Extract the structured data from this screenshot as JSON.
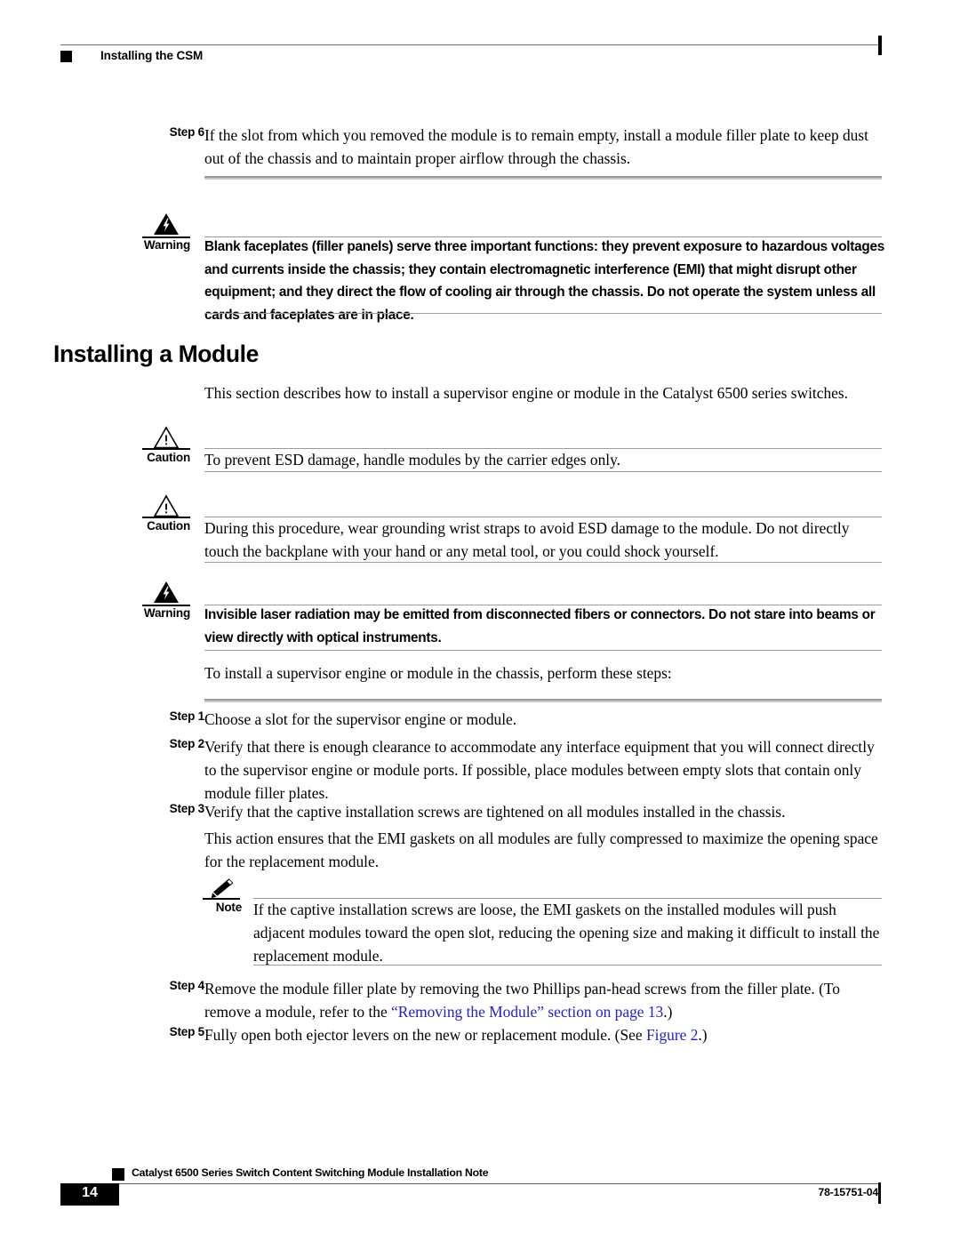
{
  "header": {
    "title": "Installing the CSM",
    "marker_icon": "black-square-bullet-icon"
  },
  "step6": {
    "label": "Step 6",
    "text": "If the slot from which you removed the module is to remain empty, install a module filler plate to keep dust out of the chassis and to maintain proper airflow through the chassis."
  },
  "warning1": {
    "label": "Warning",
    "icon": "warning-lightning-triangle-icon",
    "text": "Blank faceplates (filler panels) serve three important functions: they prevent exposure to hazardous voltages and currents inside the chassis; they contain electromagnetic interference (EMI) that might disrupt other equipment; and they direct the flow of cooling air through the chassis. Do not operate the system unless all cards and faceplates are in place."
  },
  "section": {
    "heading": "Installing a Module",
    "intro": "This section describes how to install a supervisor engine or module in the Catalyst 6500 series switches."
  },
  "caution1": {
    "label": "Caution",
    "icon": "caution-exclamation-triangle-icon",
    "text": "To prevent ESD damage, handle modules by the carrier edges only."
  },
  "caution2": {
    "label": "Caution",
    "icon": "caution-exclamation-triangle-icon",
    "text": "During this procedure, wear grounding wrist straps to avoid ESD damage to the module. Do not directly touch the backplane with your hand or any metal tool, or you could shock yourself."
  },
  "warning2": {
    "label": "Warning",
    "icon": "warning-lightning-triangle-icon",
    "text": "Invisible laser radiation may be emitted from disconnected fibers or connectors. Do not stare into beams or view directly with optical instruments."
  },
  "procedure": {
    "intro": "To install a supervisor engine or module in the chassis, perform these steps:",
    "steps": [
      {
        "label": "Step 1",
        "text": "Choose a slot for the supervisor engine or module."
      },
      {
        "label": "Step 2",
        "text": "Verify that there is enough clearance to accommodate any interface equipment that you will connect directly to the supervisor engine or module ports. If possible, place modules between empty slots that contain only module filler plates."
      },
      {
        "label": "Step 3",
        "text": "Verify that the captive installation screws are tightened on all modules installed in the chassis."
      }
    ],
    "step3_followup": "This action ensures that the EMI gaskets on all modules are fully compressed to maximize the opening space for the replacement module."
  },
  "note": {
    "label": "Note",
    "icon": "note-pencil-icon",
    "text": "If the captive installation screws are loose, the EMI gaskets on the installed modules will push adjacent modules toward the open slot, reducing the opening size and making it difficult to install the replacement module."
  },
  "step4": {
    "label": "Step 4",
    "text_before": "Remove the module filler plate by removing the two Phillips pan-head screws from the filler plate. (To remove a module, refer to the ",
    "link_text": "“Removing the Module” section on page 13",
    "text_after": ".)"
  },
  "step5": {
    "label": "Step 5",
    "text_before": "Fully open both ejector levers on the new or replacement module. (See ",
    "link_text": "Figure 2",
    "text_after": ".)"
  },
  "footer": {
    "page_number": "14",
    "title": "Catalyst 6500 Series Switch Content Switching Module Installation Note",
    "doc_number": "78-15751-04",
    "marker_icon": "black-square-bullet-icon"
  },
  "colors": {
    "link": "#2222CC",
    "rule": "#9D9D9D",
    "rule_thick": "#9A9A9A",
    "text": "#000000"
  }
}
